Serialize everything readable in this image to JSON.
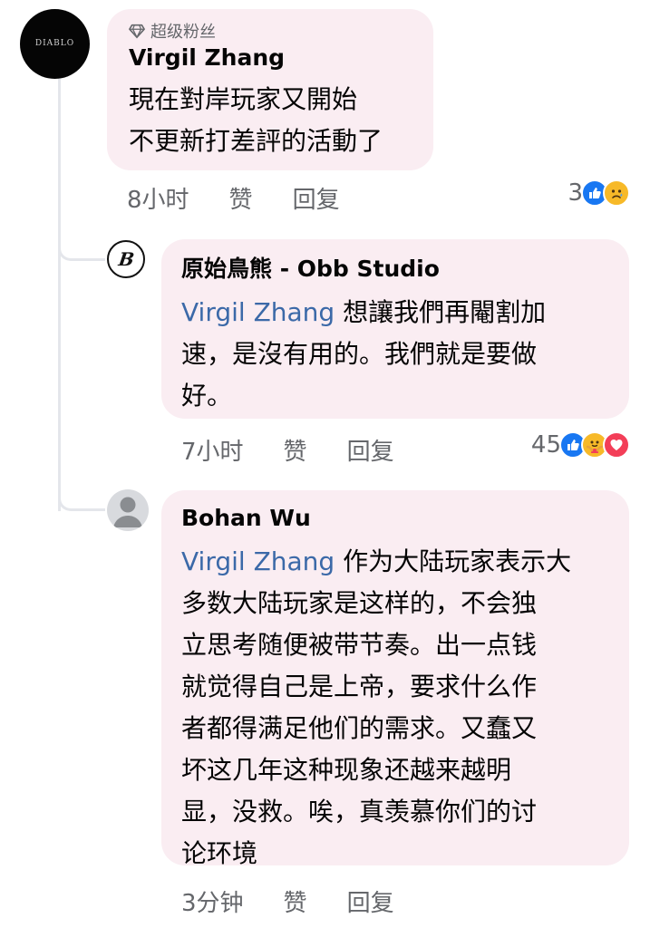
{
  "comments": [
    {
      "badge": "超级粉丝",
      "author": "Virgil Zhang",
      "lines": [
        "現在對岸玩家又開始",
        "不更新打差評的活動了"
      ],
      "time": "8小时",
      "like_label": "赞",
      "reply_label": "回复",
      "reaction_count": "3",
      "reactions": [
        "like-icon",
        "sad-icon"
      ],
      "avatar_icon": "diablo-logo-avatar",
      "avatar_text": "DIABLO"
    },
    {
      "author": "原始鳥熊 - Obb Studio",
      "mention": "Virgil Zhang",
      "lines": [
        " 想讓我們再閹割加",
        "速，是沒有用的。我們就是要做",
        "好。"
      ],
      "time": "7小时",
      "like_label": "赞",
      "reply_label": "回复",
      "reaction_count": "45",
      "reactions": [
        "like-icon",
        "care-icon",
        "love-icon"
      ],
      "avatar_icon": "obb-logo-avatar",
      "avatar_text": "B"
    },
    {
      "author": "Bohan Wu",
      "mention": "Virgil Zhang",
      "lines": [
        " 作为大陆玩家表示大",
        "多数大陆玩家是这样的，不会独",
        "立思考随便被带节奏。出一点钱",
        "就觉得自己是上帝，要求什么作",
        "者都得满足他们的需求。又蠢又",
        "坏这几年这种现象还越来越明",
        "显，没救。唉，真羡慕你们的讨",
        "论环境"
      ],
      "time": "3分钟",
      "like_label": "赞",
      "reply_label": "回复",
      "avatar_icon": "default-user-avatar"
    }
  ],
  "colors": {
    "bubble": "#faedf2",
    "mention": "#3b69a8",
    "meta": "#65676b",
    "like": "#1877f2",
    "love": "#f33e58",
    "emoji_yellow": "#f7b928"
  }
}
